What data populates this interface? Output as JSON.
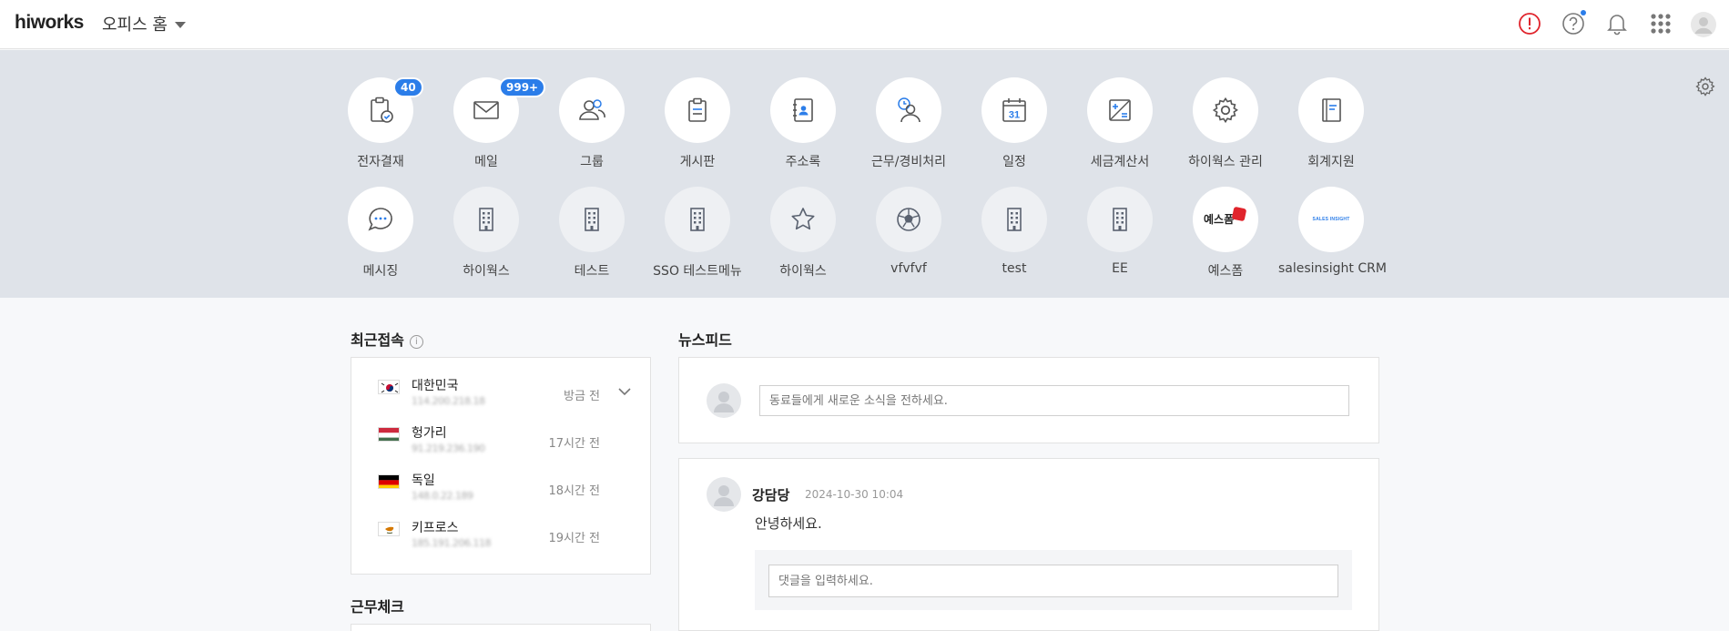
{
  "header": {
    "logo": "hiworks",
    "menu_title": "오피스 홈"
  },
  "apps_row1": [
    {
      "label": "전자결재",
      "icon": "approval-icon",
      "badge": "40"
    },
    {
      "label": "메일",
      "icon": "mail-icon",
      "badge": "999+"
    },
    {
      "label": "그룹",
      "icon": "group-icon"
    },
    {
      "label": "게시판",
      "icon": "board-icon"
    },
    {
      "label": "주소록",
      "icon": "address-book-icon"
    },
    {
      "label": "근무/경비처리",
      "icon": "work-expense-icon"
    },
    {
      "label": "일정",
      "icon": "calendar-icon",
      "calendar_day": "31"
    },
    {
      "label": "세금계산서",
      "icon": "tax-invoice-icon"
    },
    {
      "label": "하이웍스 관리",
      "icon": "admin-gear-icon"
    },
    {
      "label": "회계지원",
      "icon": "accounting-icon"
    }
  ],
  "apps_row2": [
    {
      "label": "메시징",
      "icon": "messaging-icon"
    },
    {
      "label": "하이웍스",
      "icon": "building-icon"
    },
    {
      "label": "테스트",
      "icon": "building-icon"
    },
    {
      "label": "SSO 테스트메뉴",
      "icon": "building-icon"
    },
    {
      "label": "하이웍스",
      "icon": "star-icon"
    },
    {
      "label": "vfvfvf",
      "icon": "soccer-ball-icon"
    },
    {
      "label": "test",
      "icon": "building-icon"
    },
    {
      "label": "EE",
      "icon": "building-icon"
    },
    {
      "label": "예스폼",
      "icon": "yesform-logo",
      "logo_text": "예스폼"
    },
    {
      "label": "salesinsight CRM",
      "icon": "salesinsight-logo",
      "logo_text": "SALES INSIGHT"
    }
  ],
  "recent_access": {
    "title": "최근접속",
    "info_icon": "i",
    "rows": [
      {
        "country": "대한민국",
        "ip": "114.200.218.18",
        "time": "방금 전",
        "flag": "korea-flag-icon"
      },
      {
        "country": "헝가리",
        "ip": "91.219.236.190",
        "time": "17시간 전",
        "flag": "hungary-flag-icon"
      },
      {
        "country": "독일",
        "ip": "148.0.22.189",
        "time": "18시간 전",
        "flag": "germany-flag-icon"
      },
      {
        "country": "키프로스",
        "ip": "185.191.206.118",
        "time": "19시간 전",
        "flag": "cyprus-flag-icon"
      }
    ]
  },
  "work_check": {
    "title": "근무체크"
  },
  "newsfeed": {
    "title": "뉴스피드",
    "compose_placeholder": "동료들에게 새로운 소식을 전하세요.",
    "post": {
      "author": "강담당",
      "timestamp": "2024-10-30 10:04",
      "body": "안녕하세요.",
      "comment_placeholder": "댓글을 입력하세요."
    }
  },
  "colors": {
    "accent": "#2b7de9",
    "alert": "#e0242c",
    "app_bg": "#dfe3e9",
    "page_bg": "#f7f8fa"
  }
}
